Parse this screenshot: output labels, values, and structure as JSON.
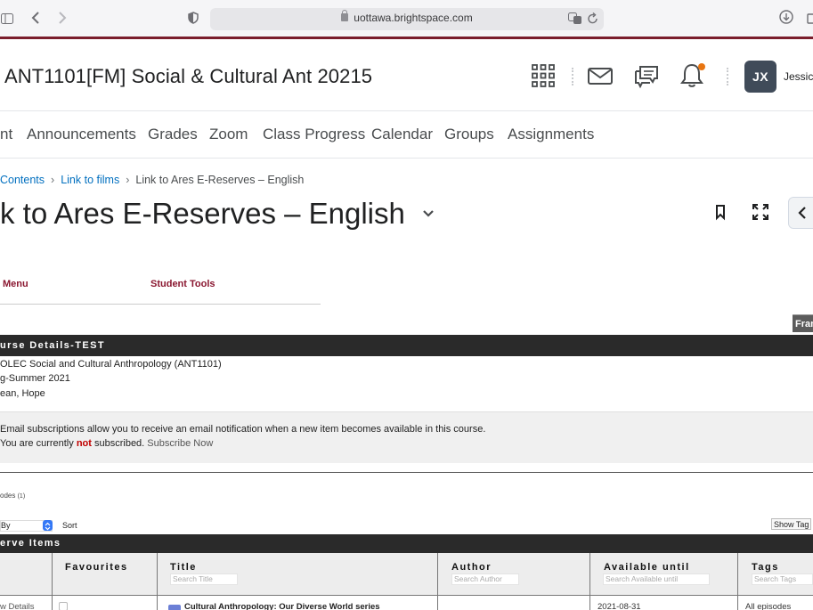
{
  "browser": {
    "url": "uottawa.brightspace.com"
  },
  "header": {
    "course_title": "ANT1101[FM] Social & Cultural Ant 20215",
    "avatar_initials": "JX",
    "user_name": "Jessica",
    "notification_color": "#e87511"
  },
  "navbar": {
    "items": [
      "nt",
      "Announcements",
      "Grades",
      "Zoom",
      "Class Progress",
      "Calendar",
      "Groups",
      "Assignments"
    ]
  },
  "breadcrumb": {
    "items": [
      "Contents",
      "Link to films"
    ],
    "current": "Link to Ares E-Reserves – English"
  },
  "page": {
    "title": "k to Ares E-Reserves – English"
  },
  "ares": {
    "menu_label": "Menu",
    "tools_label": "Student Tools",
    "frame_tab": "Fran",
    "course_details_header": "urse Details-TEST",
    "course_lines": [
      "OLEC Social and Cultural Anthropology (ANT1101)",
      "g-Summer 2021",
      "ean, Hope"
    ],
    "subscription": {
      "line1": "Email subscriptions allow you to receive an email notification when a new item becomes available in this course.",
      "line2_prefix": "You are currently ",
      "line2_not": "not",
      "line2_suffix": " subscribed.",
      "subscribe_link": "Subscribe Now"
    },
    "episodes_label": "odes",
    "episodes_count": "(1)",
    "sort_by": "By",
    "sort_button": "Sort",
    "show_tags": "Show Tag",
    "reserve_header": "erve Items",
    "table": {
      "columns": [
        "Favourites",
        "Title",
        "Author",
        "Available until",
        "Tags"
      ],
      "search_placeholders": [
        "Search Title",
        "Search Author",
        "Search Available until",
        "Search Tags"
      ],
      "row": {
        "details": "w Details",
        "title": "Cultural Anthropology: Our Diverse World series",
        "available": "2021-08-31",
        "tags": "All episodes"
      }
    }
  },
  "colors": {
    "brand_maroon": "#7a1d2c",
    "link_blue": "#006fbf",
    "ares_red": "#8a1730"
  }
}
